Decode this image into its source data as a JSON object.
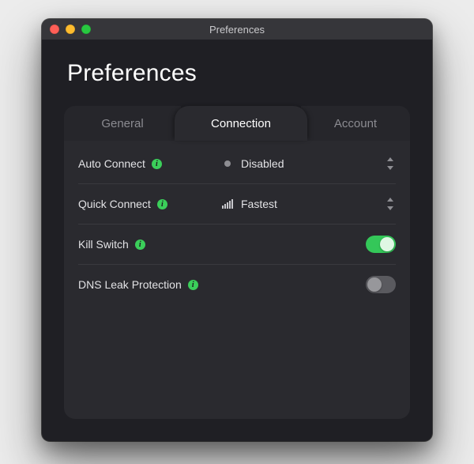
{
  "window": {
    "title": "Preferences"
  },
  "page": {
    "heading": "Preferences"
  },
  "tabs": {
    "general": "General",
    "connection": "Connection",
    "account": "Account",
    "active": "connection"
  },
  "settings": {
    "auto_connect": {
      "label": "Auto Connect",
      "value": "Disabled",
      "value_icon": "disabled-dot"
    },
    "quick_connect": {
      "label": "Quick Connect",
      "value": "Fastest",
      "value_icon": "signal-bars"
    },
    "kill_switch": {
      "label": "Kill Switch",
      "enabled": true
    },
    "dns_leak_protection": {
      "label": "DNS Leak Protection",
      "enabled": false
    }
  },
  "colors": {
    "accent_green": "#34c759",
    "info_green": "#3bcf5a"
  }
}
